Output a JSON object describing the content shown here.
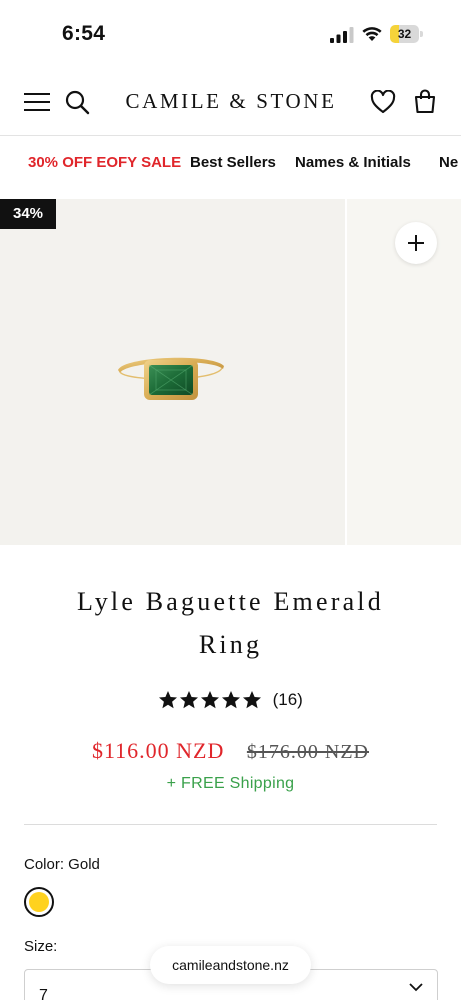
{
  "status_bar": {
    "time": "6:54",
    "battery": "32",
    "battery_level": 0.32,
    "battery_color": "#f5d33a"
  },
  "header": {
    "logo": "CAMILE & STONE",
    "icons": [
      "hamburger-menu-icon",
      "search-icon",
      "heart-icon",
      "shopping-bag-icon"
    ]
  },
  "nav": {
    "items": [
      "30% OFF EOFY SALE",
      "Best Sellers",
      "Names & Initials",
      "Ne"
    ]
  },
  "gallery": {
    "discount_badge": "34%",
    "zoom_icon": "plus-icon",
    "image": "gold-ring-with-green-emerald"
  },
  "product": {
    "title_line1": "Lyle Baguette Emerald",
    "title_line2": "Ring",
    "rating": 5,
    "review_count": "(16)",
    "price": "$116.00 NZD",
    "compare_price": "$176.00 NZD",
    "shipping": "+ FREE Shipping",
    "color_label": "Color: Gold",
    "swatch_color": "#ffd21f",
    "size_label": "Size:",
    "size_value": "7"
  },
  "browser": {
    "url": "camileandstone.nz"
  },
  "colors": {
    "sale": "#e0262b",
    "shipping": "#3aa14b",
    "gallery_bg": "#f3f2ee"
  }
}
